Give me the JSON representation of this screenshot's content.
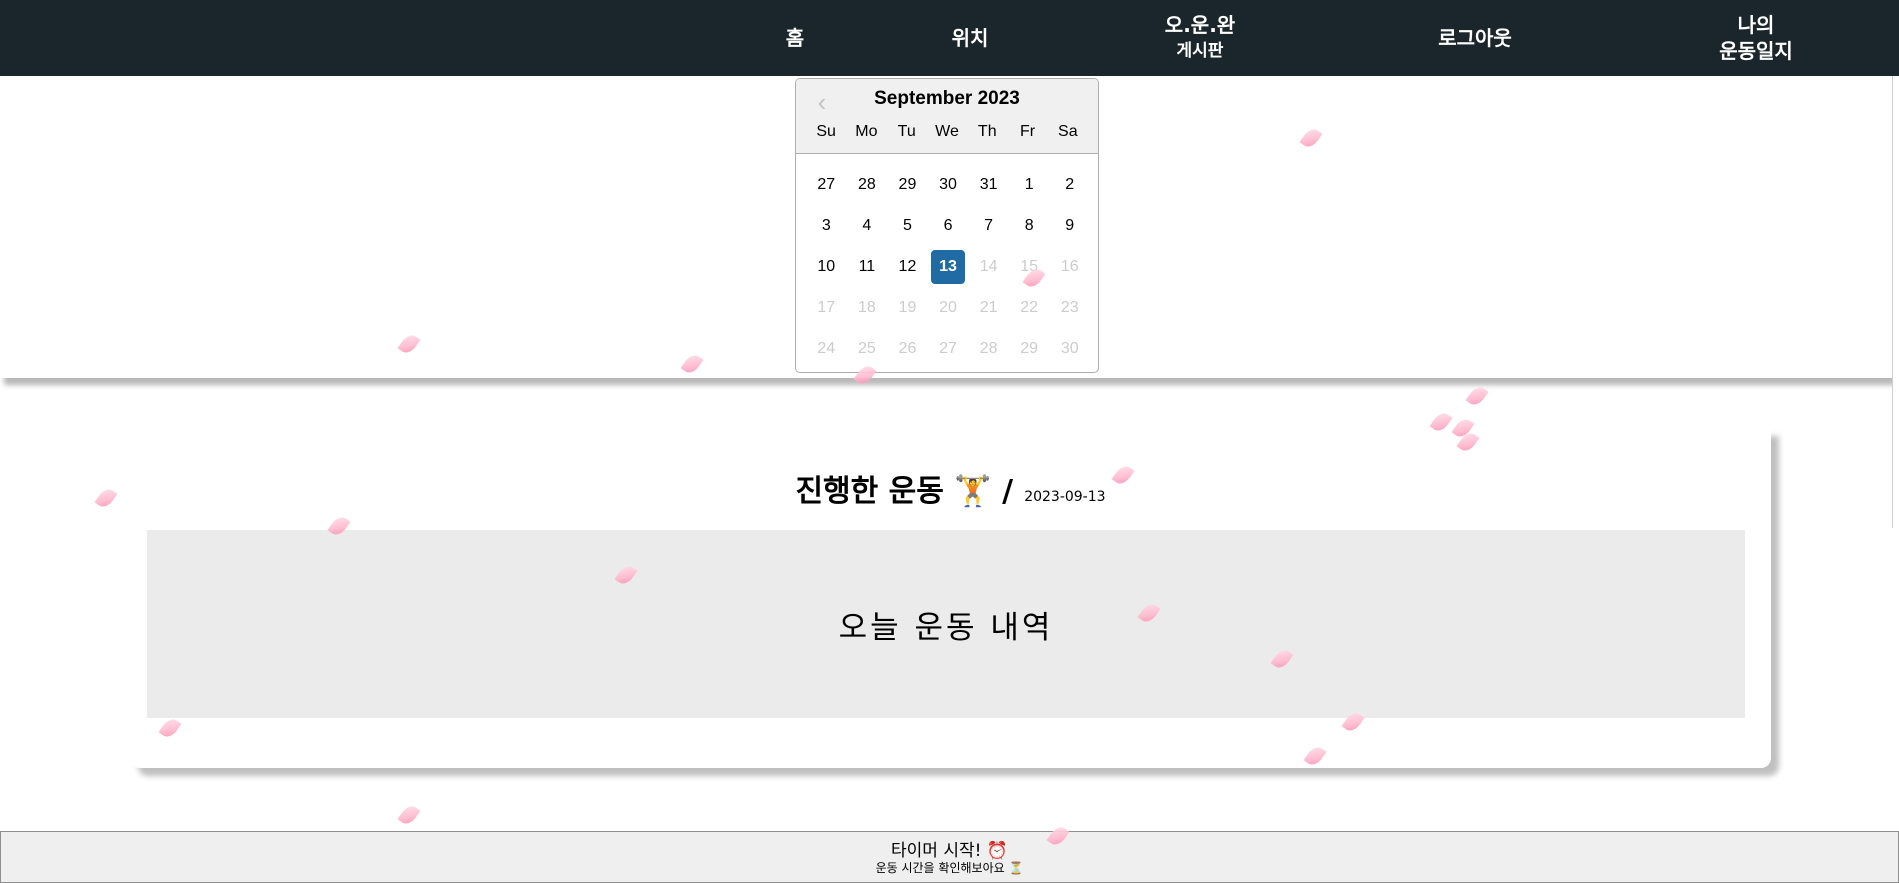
{
  "nav": {
    "home": "홈",
    "location": "위치",
    "board_line1": "오.운.완",
    "board_line2": "게시판",
    "logout": "로그아웃",
    "diary_line1": "나의",
    "diary_line2": "운동일지"
  },
  "datepicker": {
    "month_label": "September 2023",
    "prev_icon": "chevron-left-icon",
    "weekdays": [
      "Su",
      "Mo",
      "Tu",
      "We",
      "Th",
      "Fr",
      "Sa"
    ],
    "weeks": [
      [
        "27",
        "28",
        "29",
        "30",
        "31",
        "1",
        "2"
      ],
      [
        "3",
        "4",
        "5",
        "6",
        "7",
        "8",
        "9"
      ],
      [
        "10",
        "11",
        "12",
        "13",
        "14",
        "15",
        "16"
      ],
      [
        "17",
        "18",
        "19",
        "20",
        "21",
        "22",
        "23"
      ],
      [
        "24",
        "25",
        "26",
        "27",
        "28",
        "29",
        "30"
      ]
    ],
    "selected": "13",
    "selected_color": "#216ba5",
    "disabled_color": "#cccccc"
  },
  "workout": {
    "title": "진행한 운동 🏋 /",
    "date": "2023-09-13",
    "box_text": "오늘 운동 내역"
  },
  "timer": {
    "title": "타이머 시작! ⏰",
    "subtitle": "운동 시간을 확인해보아요 ⏳"
  },
  "colors": {
    "navbar_bg": "#1b262c",
    "workout_box_bg": "#ebebeb",
    "petal": "#ffb6cc"
  }
}
